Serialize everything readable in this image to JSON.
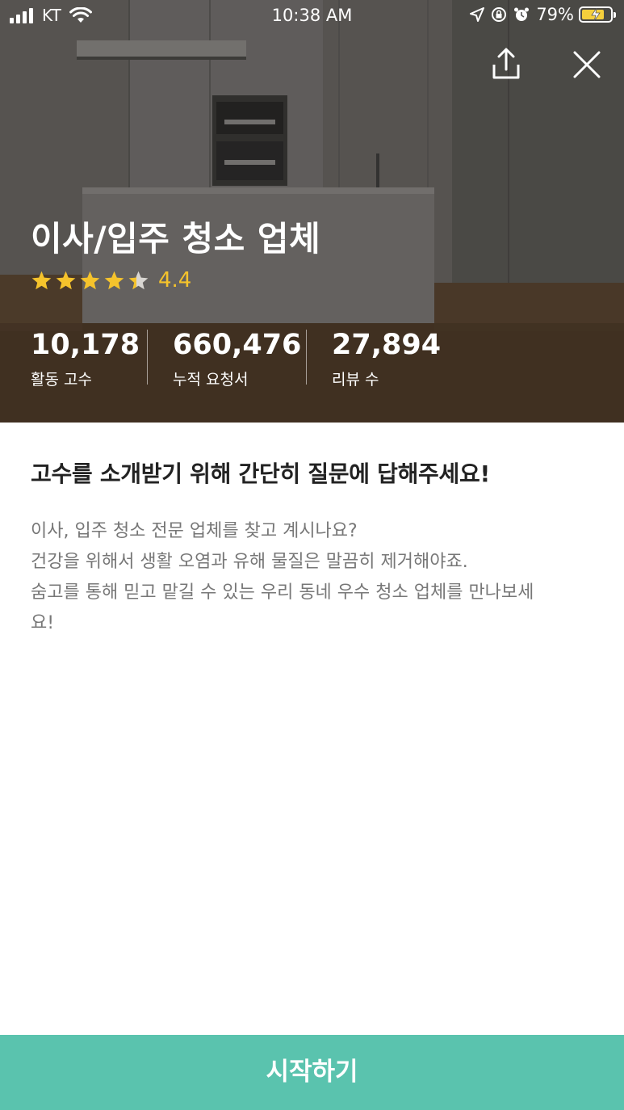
{
  "status_bar": {
    "carrier": "KT",
    "time": "10:38 AM",
    "battery_percent": "79%",
    "battery_level": 0.79,
    "icons": [
      "signal-icon",
      "wifi-icon",
      "location-icon",
      "orientation-lock-icon",
      "alarm-icon",
      "battery-icon"
    ]
  },
  "hero": {
    "title": "이사/입주 청소 업체",
    "rating_value": "4.4",
    "rating_stars": 4.4,
    "stats": [
      {
        "value": "10,178",
        "label": "활동 고수"
      },
      {
        "value": "660,476",
        "label": "누적 요청서"
      },
      {
        "value": "27,894",
        "label": "리뷰 수"
      }
    ],
    "icons": [
      "share-icon",
      "close-icon"
    ]
  },
  "content": {
    "question": "고수를 소개받기 위해 간단히 질문에 답해주세요!",
    "description": [
      "이사, 입주 청소 전문 업체를 찾고 계시나요?",
      "건강을 위해서 생활 오염과 유해 물질은 말끔히 제거해야죠.",
      "숨고를 통해 믿고 맡길 수 있는 우리 동네 우수 청소 업체를 만나보세",
      "요!"
    ]
  },
  "cta": {
    "label": "시작하기"
  },
  "colors": {
    "accent": "#5ac3ae",
    "star": "#f5c32c",
    "title_text": "#222222",
    "body_text": "#777777"
  }
}
